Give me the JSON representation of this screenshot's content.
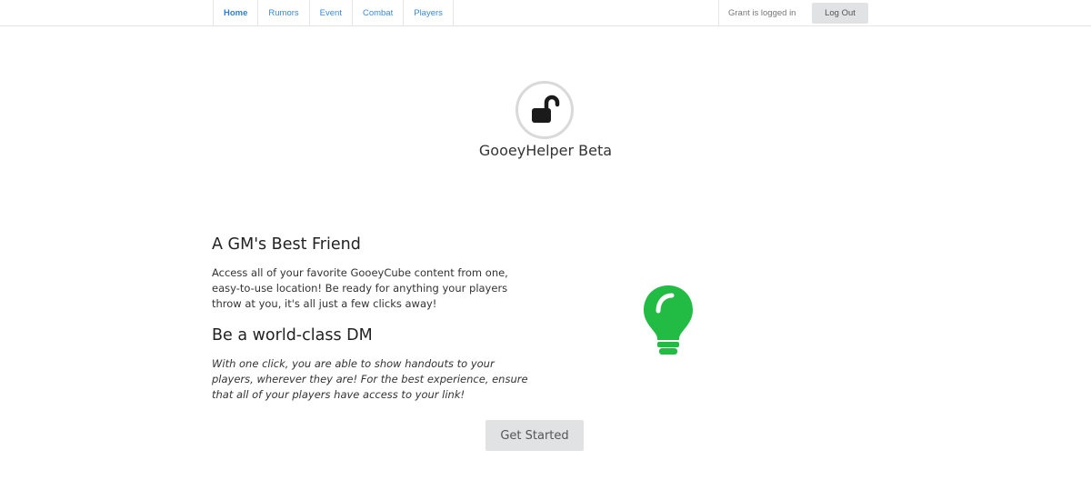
{
  "nav": {
    "tabs": [
      {
        "label": "Home",
        "active": true
      },
      {
        "label": "Rumors"
      },
      {
        "label": "Event"
      },
      {
        "label": "Combat"
      },
      {
        "label": "Players"
      }
    ],
    "user_status": "Grant is logged in",
    "logout_label": "Log Out"
  },
  "hero": {
    "logo_icon": "unlock-icon",
    "title": "GooeyHelper Beta"
  },
  "sections": [
    {
      "heading": "A GM's Best Friend",
      "text": "Access all of your favorite GooeyCube content from one, easy-to-use location! Be ready for anything your players throw at you, it's all just a few clicks away!"
    },
    {
      "heading": "Be a world-class DM",
      "text": "With one click, you are able to show handouts to your players, wherever they are! For the best experience, ensure that all of your players have access to your link!"
    }
  ],
  "cta": {
    "label": "Get Started"
  },
  "illustration": {
    "icon": "lightbulb-icon",
    "color": "#22bb44"
  }
}
